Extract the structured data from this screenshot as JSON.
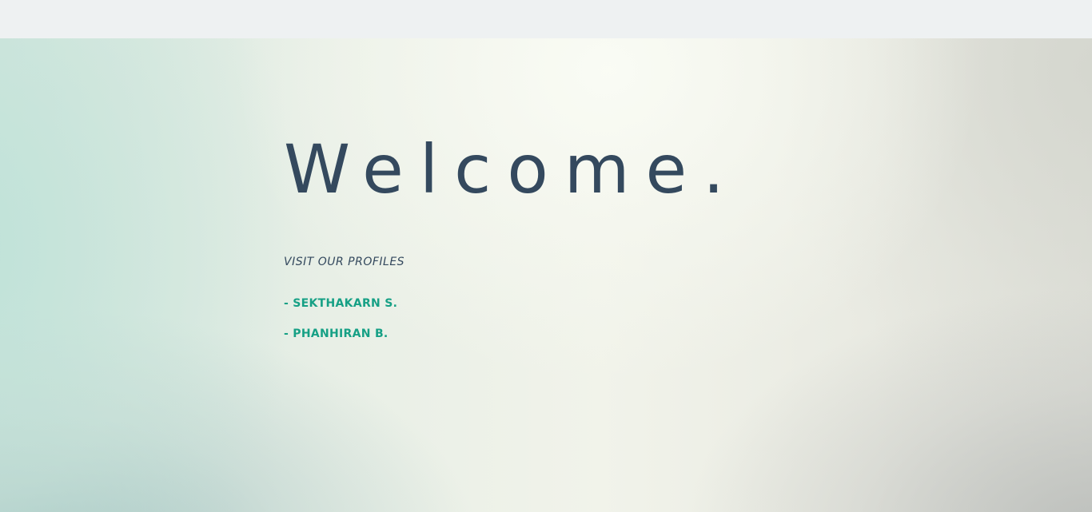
{
  "hero": {
    "title": "Welcome.",
    "profiles_heading": "VISIT OUR PROFILES",
    "profiles": [
      {
        "label": "- SEKTHAKARN S."
      },
      {
        "label": "- PHANHIRAN B."
      }
    ]
  },
  "colors": {
    "title": "#34495e",
    "link": "#16a085",
    "topbar": "#eef1f2"
  }
}
